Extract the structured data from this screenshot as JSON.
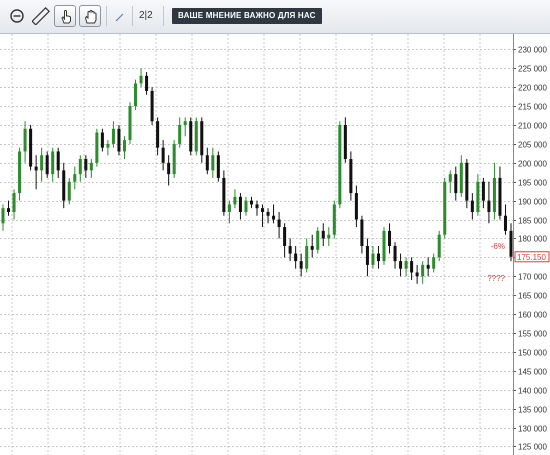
{
  "toolbar": {
    "buttons": [
      {
        "icon": "zoom-out-icon"
      },
      {
        "icon": "ruler-icon"
      },
      {
        "icon": "hand-pointer-icon",
        "active": true
      },
      {
        "icon": "hand-grab-icon",
        "active": true
      },
      {
        "icon": "pen-icon"
      }
    ],
    "counter_text": "2|2",
    "banner_text": "ВАШЕ МНЕНИЕ ВАЖНО ДЛЯ НАС"
  },
  "colors": {
    "up": "#2e8b2e",
    "down": "#111111",
    "grid": "#c8c8c8",
    "annotation": "#d04040",
    "last_price_box": "#d04040"
  },
  "chart_data": {
    "type": "candlestick",
    "ylim": [
      123000,
      233000
    ],
    "y_ticks": [
      "230 000",
      "225 000",
      "220 000",
      "215 000",
      "210 000",
      "205 000",
      "200 000",
      "195 000",
      "190 000",
      "185 000",
      "180 000",
      "175 000",
      "170 000",
      "165 000",
      "160 000",
      "155 000",
      "150 000",
      "145 000",
      "140 000",
      "135 000",
      "130 000",
      "125 000"
    ],
    "y_tick_values": [
      230000,
      225000,
      220000,
      215000,
      210000,
      205000,
      200000,
      195000,
      190000,
      185000,
      180000,
      175000,
      170000,
      165000,
      160000,
      155000,
      150000,
      145000,
      140000,
      135000,
      130000,
      125000
    ],
    "last_price": 175150,
    "last_price_label": "175.150",
    "annotations": [
      {
        "text": "-6%",
        "value": 178000
      },
      {
        "text": "????",
        "value": 169500
      }
    ],
    "candles": [
      [
        184,
        189,
        182,
        188
      ],
      [
        188,
        190,
        186,
        187
      ],
      [
        187,
        193,
        185,
        192
      ],
      [
        192,
        204,
        190,
        203
      ],
      [
        203,
        211,
        200,
        209
      ],
      [
        209,
        210,
        198,
        199
      ],
      [
        199,
        202,
        193,
        198
      ],
      [
        198,
        204,
        195,
        202
      ],
      [
        202,
        203,
        196,
        197
      ],
      [
        197,
        204,
        195,
        203
      ],
      [
        203,
        204,
        196,
        198
      ],
      [
        198,
        200,
        188,
        190
      ],
      [
        190,
        196,
        189,
        195
      ],
      [
        195,
        199,
        193,
        197
      ],
      [
        197,
        202,
        195,
        201
      ],
      [
        201,
        202,
        196,
        198
      ],
      [
        198,
        201,
        196,
        200
      ],
      [
        200,
        209,
        199,
        208
      ],
      [
        208,
        209,
        203,
        204
      ],
      [
        204,
        206,
        202,
        205
      ],
      [
        205,
        211,
        204,
        209
      ],
      [
        209,
        210,
        202,
        203
      ],
      [
        203,
        207,
        201,
        206
      ],
      [
        206,
        216,
        205,
        215
      ],
      [
        215,
        222,
        214,
        221
      ],
      [
        221,
        225,
        220,
        223
      ],
      [
        223,
        224,
        218,
        219
      ],
      [
        219,
        220,
        210,
        211
      ],
      [
        211,
        212,
        202,
        204
      ],
      [
        204,
        206,
        198,
        200
      ],
      [
        200,
        202,
        194,
        197
      ],
      [
        197,
        206,
        196,
        205
      ],
      [
        205,
        212,
        204,
        210
      ],
      [
        210,
        212,
        207,
        211
      ],
      [
        211,
        212,
        202,
        203
      ],
      [
        203,
        212,
        202,
        211
      ],
      [
        211,
        212,
        200,
        202
      ],
      [
        202,
        204,
        197,
        198
      ],
      [
        198,
        204,
        196,
        202
      ],
      [
        202,
        203,
        195,
        196
      ],
      [
        196,
        198,
        186,
        187
      ],
      [
        187,
        190,
        184,
        189
      ],
      [
        189,
        193,
        188,
        191
      ],
      [
        191,
        192,
        185,
        187
      ],
      [
        187,
        191,
        186,
        190
      ],
      [
        190,
        191,
        188,
        189
      ],
      [
        189,
        190,
        186,
        188
      ],
      [
        188,
        189,
        183,
        187
      ],
      [
        187,
        188,
        184,
        186
      ],
      [
        186,
        189,
        184,
        185
      ],
      [
        185,
        187,
        180,
        183
      ],
      [
        183,
        184,
        175,
        178
      ],
      [
        178,
        180,
        174,
        176
      ],
      [
        176,
        178,
        172,
        174
      ],
      [
        174,
        176,
        170,
        172
      ],
      [
        172,
        180,
        171,
        178
      ],
      [
        178,
        181,
        175,
        177
      ],
      [
        177,
        183,
        176,
        182
      ],
      [
        182,
        184,
        178,
        180
      ],
      [
        180,
        183,
        178,
        181
      ],
      [
        181,
        190,
        180,
        189
      ],
      [
        189,
        211,
        188,
        210
      ],
      [
        210,
        212,
        200,
        201
      ],
      [
        201,
        203,
        190,
        192
      ],
      [
        192,
        194,
        183,
        185
      ],
      [
        185,
        186,
        176,
        178
      ],
      [
        178,
        180,
        170,
        173
      ],
      [
        173,
        178,
        172,
        176
      ],
      [
        176,
        178,
        172,
        174
      ],
      [
        174,
        183,
        173,
        182
      ],
      [
        182,
        184,
        176,
        178
      ],
      [
        178,
        179,
        172,
        174
      ],
      [
        174,
        176,
        170,
        172
      ],
      [
        172,
        175,
        170,
        174
      ],
      [
        174,
        175,
        169,
        171
      ],
      [
        171,
        173,
        168,
        170
      ],
      [
        170,
        174,
        168,
        173
      ],
      [
        173,
        175,
        170,
        172
      ],
      [
        172,
        176,
        171,
        175
      ],
      [
        175,
        182,
        174,
        181
      ],
      [
        181,
        196,
        180,
        195
      ],
      [
        195,
        198,
        192,
        197
      ],
      [
        197,
        199,
        190,
        192
      ],
      [
        192,
        202,
        191,
        200
      ],
      [
        200,
        201,
        188,
        190
      ],
      [
        190,
        192,
        185,
        187
      ],
      [
        187,
        197,
        186,
        195
      ],
      [
        195,
        196,
        188,
        190
      ],
      [
        190,
        195,
        184,
        187
      ],
      [
        187,
        200,
        185,
        196
      ],
      [
        196,
        199,
        185,
        186
      ],
      [
        186,
        189,
        181,
        182
      ],
      [
        182,
        184,
        174,
        175.15
      ]
    ]
  }
}
